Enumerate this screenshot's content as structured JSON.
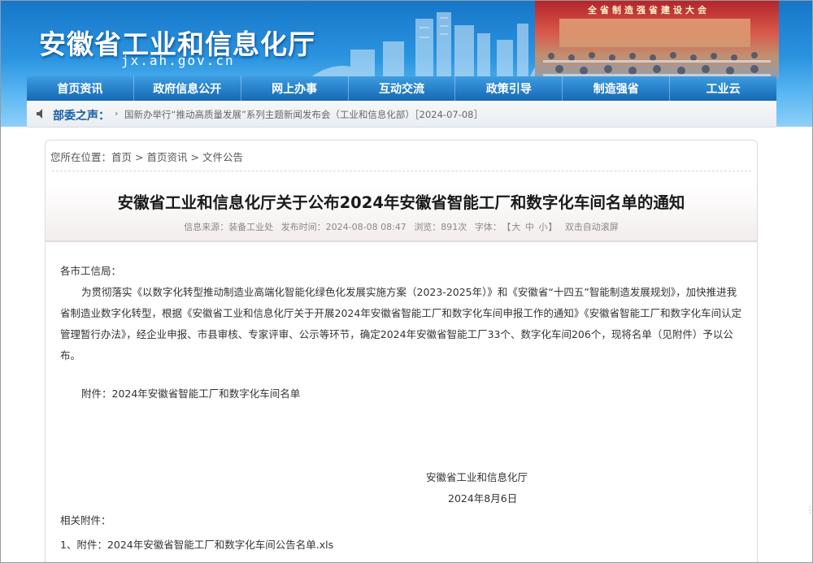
{
  "header": {
    "site_title": "安徽省工业和信息化厅",
    "site_domain": "jx.ah.gov.cn",
    "banner_caption": "全省制造强省建设大会"
  },
  "nav": {
    "items": [
      "首页资讯",
      "政府信息公开",
      "网上办事",
      "互动交流",
      "政策引导",
      "制造强省",
      "工业云"
    ]
  },
  "ticker": {
    "label": "部委之声：",
    "text": "国新办举行“推动高质量发展”系列主题新闻发布会（工业和信息化部）［2024-07-08］"
  },
  "breadcrumb": {
    "prefix": "您所在位置：",
    "items": [
      "首页",
      "首页资讯",
      "文件公告"
    ]
  },
  "article": {
    "title": "安徽省工业和信息化厅关于公布2024年安徽省智能工厂和数字化车间名单的通知",
    "meta": {
      "source": "信息来源：装备工业处",
      "published": "发布时间：2024-08-08 08:47",
      "views": "浏览：891次",
      "font_label": "字体：",
      "font_large": "大",
      "font_medium": "中",
      "font_small": "小",
      "auto_scroll": "双击自动滚屏"
    },
    "salutation": "各市工信局：",
    "paragraph": "为贯彻落实《以数字化转型推动制造业高端化智能化绿色化发展实施方案（2023-2025年）》和《安徽省“十四五”智能制造发展规划》，加快推进我省制造业数字化转型，根据《安徽省工业和信息化厅关于开展2024年安徽省智能工厂和数字化车间申报工作的通知》《安徽省智能工厂和数字化车间认定管理暂行办法》，经企业申报、市县审核、专家评审、公示等环节，确定2024年安徽省智能工厂33个、数字化车间206个，现将名单（见附件）予以公布。",
    "attachment_line": "附件：2024年安徽省智能工厂和数字化车间名单",
    "signature_org": "安徽省工业和信息化厅",
    "signature_date": "2024年8月6日",
    "related_label": "相关附件：",
    "related_files": [
      "1、附件：2024年安徽省智能工厂和数字化车间公告名单.xls"
    ]
  },
  "colors": {
    "header_blue": "#1676c8",
    "nav_blue": "#1569b5",
    "ticker_label": "#1a5fa8",
    "conference_red": "#b2252b"
  }
}
